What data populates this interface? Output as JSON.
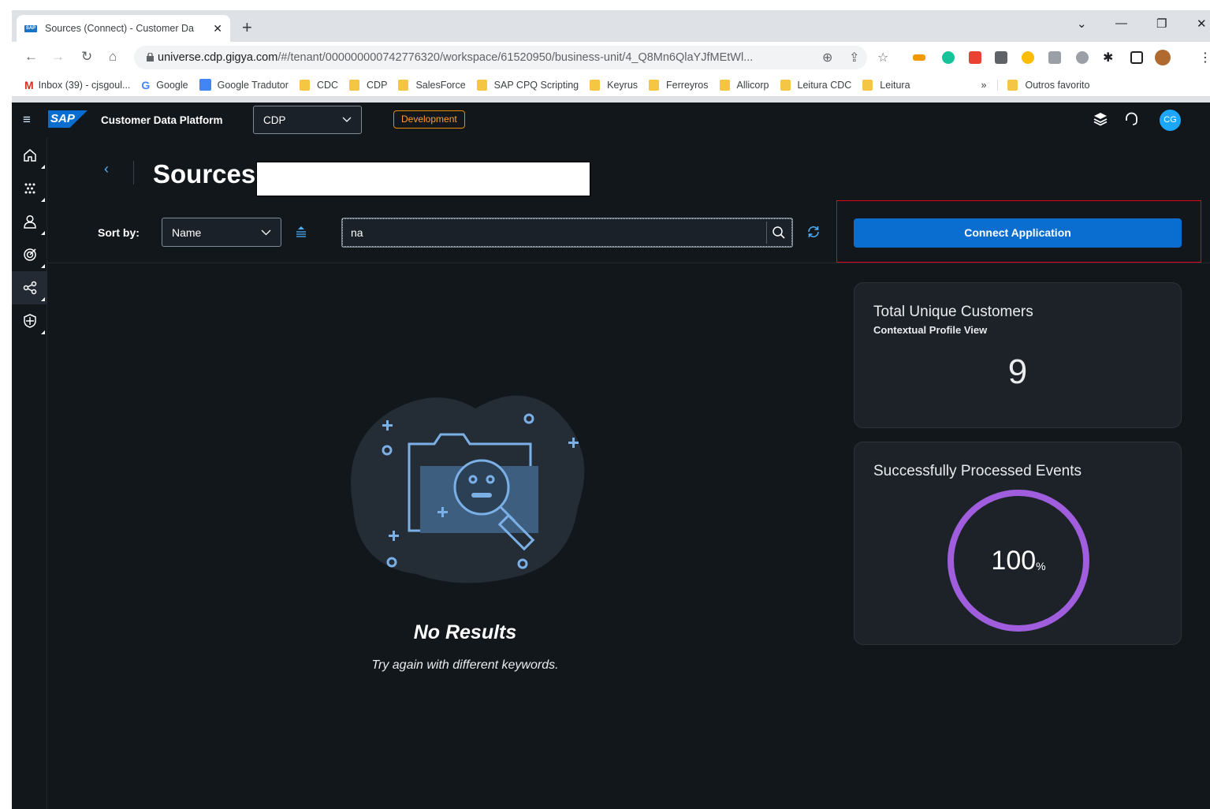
{
  "browser": {
    "tab_title": "Sources (Connect) - Customer Da",
    "url_host": "universe.cdp.gigya.com",
    "url_path": "/#/tenant/000000000742776320/workspace/61520950/business-unit/4_Q8Mn6QlaYJfMEtWl...",
    "bookmarks": [
      {
        "label": "Inbox (39) - cjsgoul...",
        "icon": "gmail-icon"
      },
      {
        "label": "Google",
        "icon": "google-icon"
      },
      {
        "label": "Google Tradutor",
        "icon": "translate-icon"
      },
      {
        "label": "CDC",
        "icon": "folder-icon"
      },
      {
        "label": "CDP",
        "icon": "folder-icon"
      },
      {
        "label": "SalesForce",
        "icon": "folder-icon"
      },
      {
        "label": "SAP CPQ Scripting",
        "icon": "folder-icon"
      },
      {
        "label": "Keyrus",
        "icon": "folder-icon"
      },
      {
        "label": "Ferreyros",
        "icon": "folder-icon"
      },
      {
        "label": "Allicorp",
        "icon": "folder-icon"
      },
      {
        "label": "Leitura CDC",
        "icon": "folder-icon"
      },
      {
        "label": "Leitura",
        "icon": "folder-icon"
      }
    ],
    "bookmarks_overflow": "»",
    "other_bookmarks": "Outros favorito"
  },
  "shell": {
    "logo_text": "SAP",
    "app_title": "Customer Data Platform",
    "tenant_select": "CDP",
    "env_badge": "Development",
    "avatar_initials": "CG"
  },
  "page": {
    "title": "Sources",
    "sort_label": "Sort by:",
    "sort_value": "Name",
    "search_value": "na",
    "connect_button": "Connect Application"
  },
  "empty_state": {
    "title": "No Results",
    "subtitle": "Try again with different keywords."
  },
  "cards": {
    "customers": {
      "title": "Total Unique Customers",
      "subtitle": "Contextual Profile View",
      "value": "9"
    },
    "events": {
      "title": "Successfully Processed Events",
      "value": "100",
      "unit": "%",
      "fraction": 1.0
    }
  },
  "colors": {
    "accent": "#0a6ed1",
    "ring": "#a05ede",
    "highlight": "#e0001a",
    "env_badge": "#ff9c31"
  }
}
